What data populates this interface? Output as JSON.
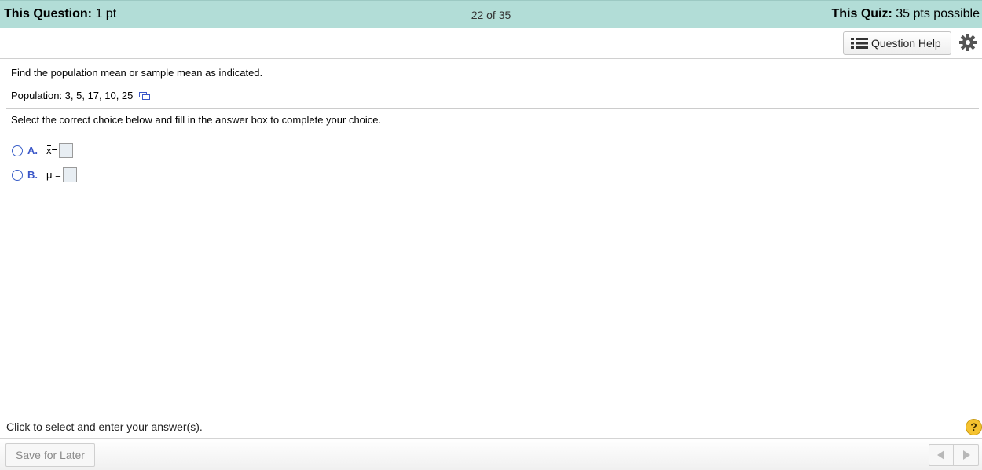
{
  "header": {
    "question_label": "This Question:",
    "question_points": "1 pt",
    "progress": "22 of 35",
    "quiz_label": "This Quiz:",
    "quiz_points": "35 pts possible"
  },
  "toolbar": {
    "question_help_label": "Question Help",
    "question_help_icon": "list-icon",
    "settings_icon": "gear-icon"
  },
  "question": {
    "instruction": "Find the population mean or sample mean as indicated.",
    "population": "Population: 3, 5, 17, 10, 25",
    "select_prompt": "Select the correct choice below and fill in the answer box to complete your choice.",
    "choices": [
      {
        "letter": "A.",
        "symbol": "x",
        "overline": true,
        "equals": "=",
        "value": ""
      },
      {
        "letter": "B.",
        "symbol": "μ",
        "overline": false,
        "equals": "=",
        "value": ""
      }
    ]
  },
  "hint": "Click to select and enter your answer(s).",
  "help_badge": "?",
  "footer": {
    "save_label": "Save for Later",
    "prev_icon": "triangle-left-icon",
    "next_icon": "triangle-right-icon"
  },
  "colors": {
    "header_bg": "#b2ddd7",
    "choice_letter": "#3a56c8",
    "help_badge": "#f5c230"
  }
}
